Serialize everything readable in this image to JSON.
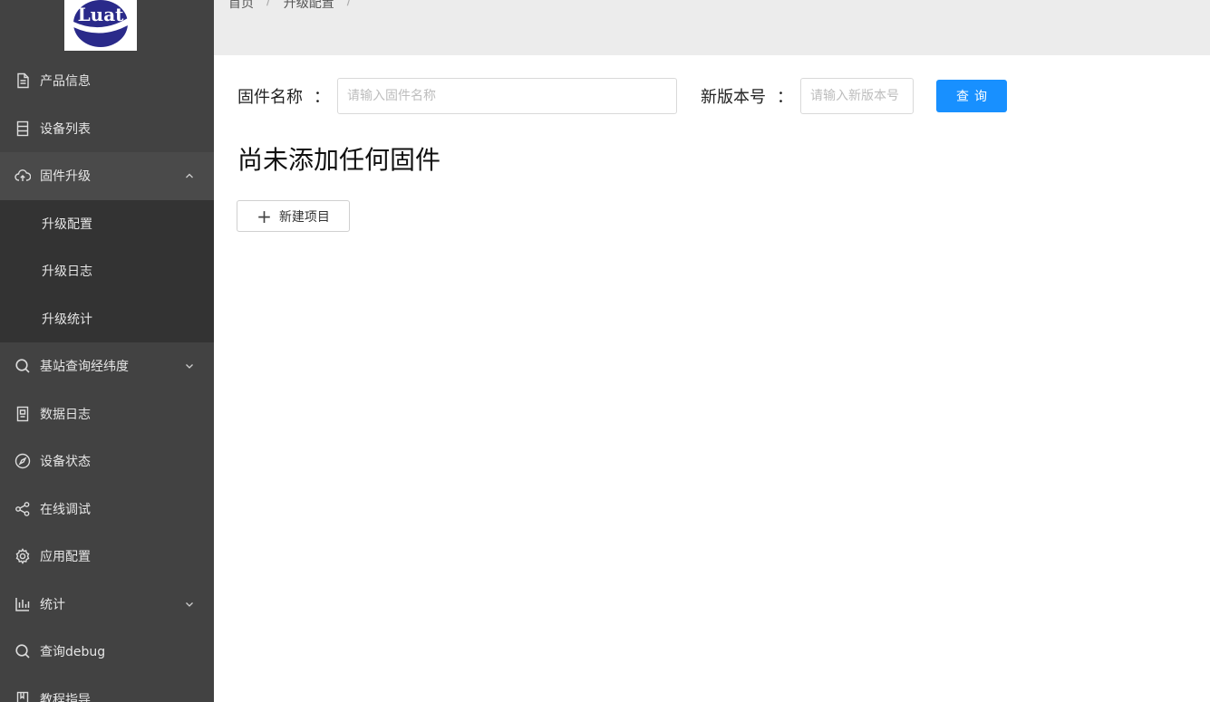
{
  "logo": {
    "text": "Luat"
  },
  "sidebar": {
    "items": [
      {
        "label": "产品信息",
        "icon": "file-icon"
      },
      {
        "label": "设备列表",
        "icon": "list-icon"
      },
      {
        "label": "固件升级",
        "icon": "cloud-upload-icon",
        "expanded": true,
        "children": [
          {
            "label": "升级配置"
          },
          {
            "label": "升级日志"
          },
          {
            "label": "升级统计"
          }
        ]
      },
      {
        "label": "基站查询经纬度",
        "icon": "search-icon",
        "expandable": true
      },
      {
        "label": "数据日志",
        "icon": "book-icon"
      },
      {
        "label": "设备状态",
        "icon": "compass-icon"
      },
      {
        "label": "在线调试",
        "icon": "share-icon"
      },
      {
        "label": "应用配置",
        "icon": "gear-icon"
      },
      {
        "label": "统计",
        "icon": "bar-chart-icon",
        "expandable": true
      },
      {
        "label": "查询debug",
        "icon": "search-icon"
      },
      {
        "label": "教程指导",
        "icon": "book-open-icon"
      }
    ]
  },
  "breadcrumb": {
    "items": [
      "首页",
      "升级配置"
    ],
    "separator": "/"
  },
  "form": {
    "firmware_label": "固件名称",
    "firmware_placeholder": "请输入固件名称",
    "version_label": "新版本号",
    "version_placeholder": "请输入新版本号",
    "colon": "：",
    "query_button": "查询"
  },
  "empty_title": "尚未添加任何固件",
  "new_button": "新建项目",
  "colors": {
    "sidebar_bg": "#424242",
    "submenu_bg": "#333333",
    "primary": "#1890ff",
    "header_bg": "#ececec"
  }
}
